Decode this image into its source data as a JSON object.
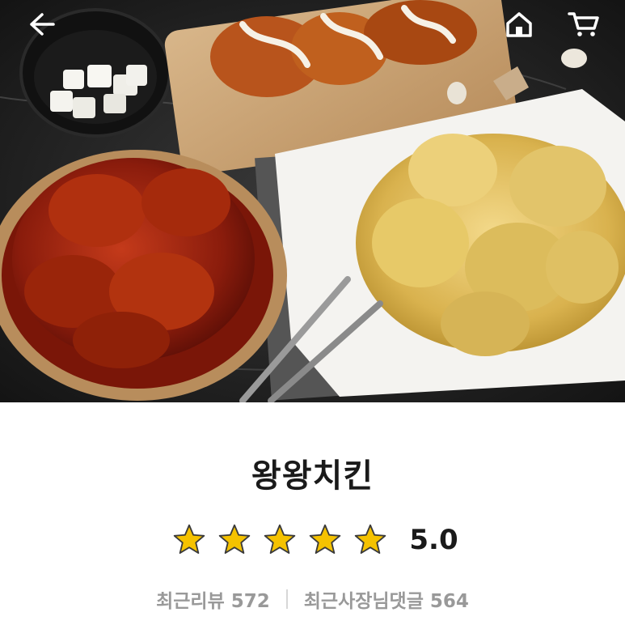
{
  "store": {
    "name": "왕왕치킨",
    "rating": "5.0",
    "stars_filled": 5,
    "stars_total": 5
  },
  "stats": {
    "reviews_label": "최근리뷰",
    "reviews_count": "572",
    "owner_replies_label": "최근사장님댓글",
    "owner_replies_count": "564"
  },
  "icons": {
    "back": "back-arrow-icon",
    "home": "home-icon",
    "cart": "cart-icon",
    "star": "star-icon"
  },
  "colors": {
    "star": "#f5c200",
    "title": "#1a1a1a",
    "muted": "#999999"
  }
}
